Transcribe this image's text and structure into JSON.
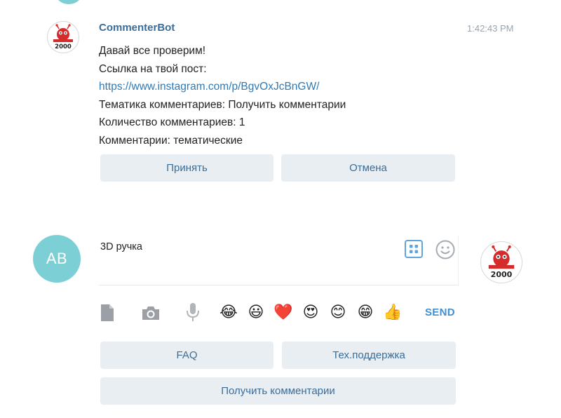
{
  "message": {
    "sender": "CommenterBot",
    "time": "1:42:43 PM",
    "lines": [
      "Давай все проверим!",
      "Ссылка на твой пост:",
      "https://www.instagram.com/p/BgvOxJcBnGW/",
      "Тематика комментариев: Получить комментарии",
      "Количество комментариев: 1",
      "Комментарии: тематические"
    ],
    "buttons": [
      "Принять",
      "Отмена"
    ]
  },
  "bot_logo_text": "2000",
  "composer": {
    "user_initials": "AB",
    "input_value": "3D ручка",
    "send_label": "SEND",
    "emojis": [
      "😂",
      "😃",
      "❤️",
      "😍",
      "😊",
      "😁",
      "👍"
    ]
  },
  "keyboard": {
    "row1": [
      "FAQ",
      "Тех.поддержка"
    ],
    "row2": [
      "Получить комментарии"
    ]
  },
  "icons": [
    "file-icon",
    "camera-icon",
    "microphone-icon",
    "keyboard-grid-icon",
    "smile-icon"
  ],
  "colors": {
    "accent": "#3a6d99",
    "link": "#2f7ab5",
    "send": "#3f8fd5",
    "avatar": "#7ccfd4",
    "button_bg": "#e9eef3",
    "logo_red": "#d62b2b"
  }
}
